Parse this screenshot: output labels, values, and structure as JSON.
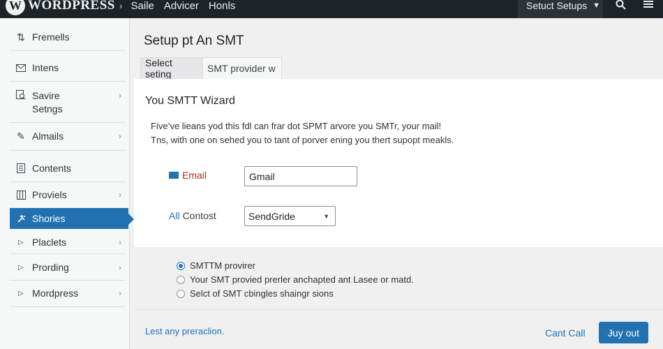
{
  "topbar": {
    "logo_glyph": "W",
    "logo_text": "WORDPRESS",
    "nav": [
      "Saile",
      "Advicer",
      "Honls"
    ],
    "setup_dropdown": "Setuct Setups",
    "icons": {
      "search": "search-icon",
      "menu": "hamburger-menu-icon"
    }
  },
  "sidebar": {
    "items": [
      {
        "label": "Fremells",
        "icon": "sort-arrows-icon",
        "chevron": false
      },
      {
        "label": "Intens",
        "icon": "mail-icon",
        "chevron": false
      },
      {
        "label": "Savire\nSetngs",
        "icon": "search-doc-icon",
        "chevron": true
      },
      {
        "label": "Almails",
        "icon": "pen-icon",
        "chevron": true
      },
      {
        "label": "Contents",
        "icon": "document-icon",
        "chevron": false
      },
      {
        "label": "Proviels",
        "icon": "columns-icon",
        "chevron": true
      },
      {
        "label": "Shories",
        "icon": "plugin-icon",
        "chevron": false,
        "active": true
      },
      {
        "label": "Placlets",
        "icon": "triangle-right-icon",
        "chevron": true
      },
      {
        "label": "Prording",
        "icon": "triangle-right-icon",
        "chevron": true
      },
      {
        "label": "Mordpress",
        "icon": "triangle-right-icon",
        "chevron": true
      }
    ]
  },
  "main": {
    "title": "Setup pt An SMT",
    "tabs": [
      {
        "label": "Select seting",
        "active": true
      },
      {
        "label": "SMT provider w",
        "active": false
      }
    ],
    "wizard": {
      "title": "You SMTT Wizard",
      "desc_line1": "Five’ve lieans yod this fdl can frar dot SPMT arvore you SMTr, your mail!",
      "desc_line2": "Tns, with one on sehed you to tant of porver ening you thert supopt meakls.",
      "email_label": "Email",
      "email_value": "Gmail",
      "contost_prefix": "All",
      "contost_label": "Contost",
      "contost_value": "SendGride"
    },
    "radios": [
      {
        "label": "SMTTM provirer",
        "checked": true
      },
      {
        "label": "Your SMT provied prerler anchapted ant Lasee or matd.",
        "checked": false
      },
      {
        "label": "Selct of SMT cbingles shaingr sions",
        "checked": false
      }
    ],
    "footer": {
      "link": "Lest any preraclion.",
      "cancel": "Cant Call",
      "primary": "Ɉuy out"
    }
  },
  "colors": {
    "accent": "#2271b1",
    "topbar": "#1d2327",
    "email_label": "#b32d2e"
  }
}
